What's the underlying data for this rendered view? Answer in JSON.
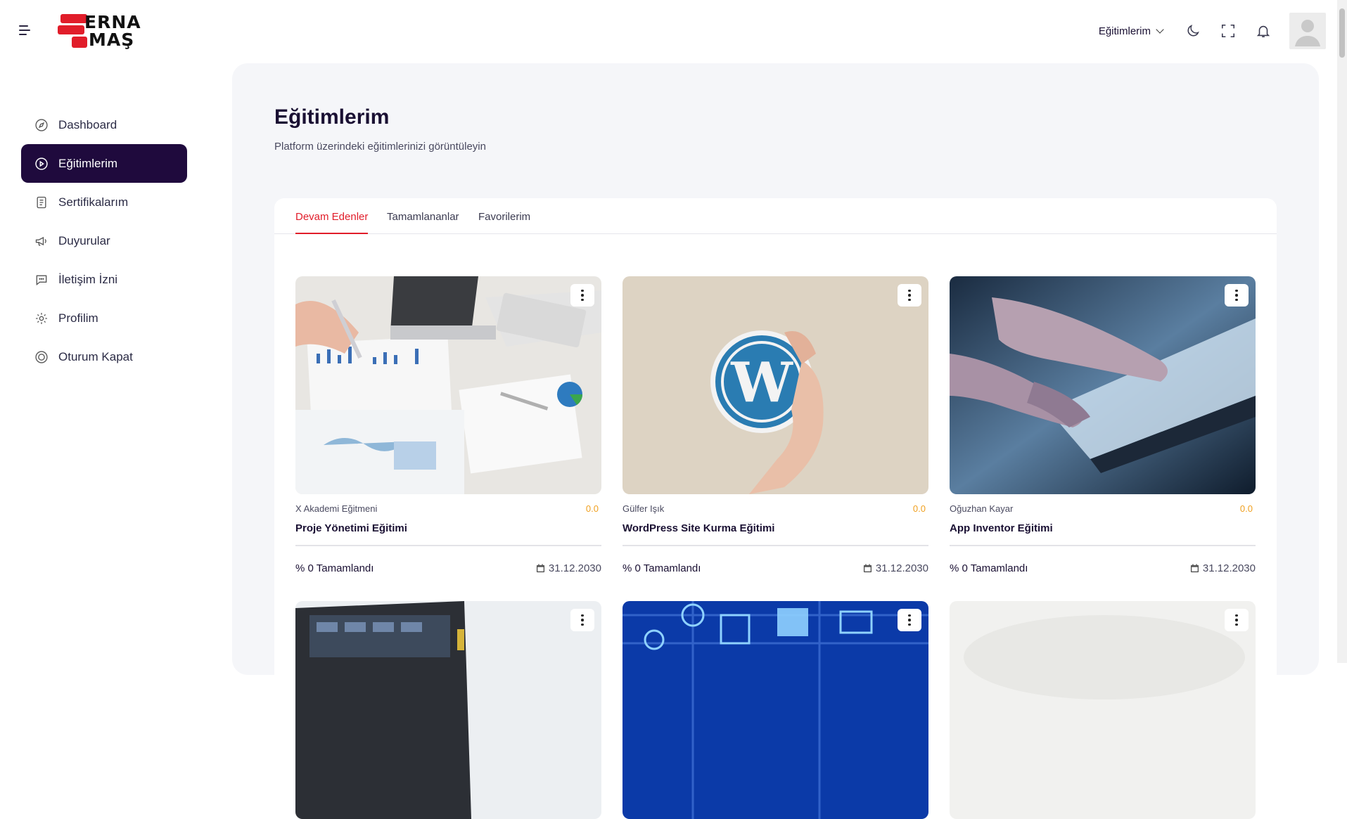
{
  "brand": {
    "logo_line1": "ERNA",
    "logo_line2": "MAŞ",
    "accent": "#e11d2a",
    "dark": "#1f0a3d"
  },
  "header": {
    "context_select": "Eğitimlerim",
    "icons": [
      "moon-icon",
      "fullscreen-icon",
      "bell-icon",
      "avatar"
    ]
  },
  "sidebar": {
    "items": [
      {
        "label": "Dashboard",
        "icon": "compass-icon",
        "active": false
      },
      {
        "label": "Eğitimlerim",
        "icon": "play-circle-icon",
        "active": true
      },
      {
        "label": "Sertifikalarım",
        "icon": "certificate-icon",
        "active": false
      },
      {
        "label": "Duyurular",
        "icon": "megaphone-icon",
        "active": false
      },
      {
        "label": "İletişim İzni",
        "icon": "chat-icon",
        "active": false
      },
      {
        "label": "Profilim",
        "icon": "gear-icon",
        "active": false
      },
      {
        "label": "Oturum Kapat",
        "icon": "logout-circle-icon",
        "active": false
      }
    ]
  },
  "main": {
    "title": "Eğitimlerim",
    "subtitle": "Platform üzerindeki eğitimlerinizi görüntüleyin",
    "tabs": [
      {
        "label": "Devam Edenler",
        "active": true
      },
      {
        "label": "Tamamlananlar",
        "active": false
      },
      {
        "label": "Favorilerim",
        "active": false
      }
    ],
    "courses": [
      {
        "instructor": "X Akademi Eğitmeni",
        "rating": "0.0",
        "title": "Proje Yönetimi Eğitimi",
        "progress": "% 0 Tamamlandı",
        "date": "31.12.2030",
        "image": "business-charts-photo"
      },
      {
        "instructor": "Gülfer Işık",
        "rating": "0.0",
        "title": "WordPress Site Kurma Eğitimi",
        "progress": "% 0 Tamamlandı",
        "date": "31.12.2030",
        "image": "wordpress-logo-photo"
      },
      {
        "instructor": "Oğuzhan Kayar",
        "rating": "0.0",
        "title": "App Inventor Eğitimi",
        "progress": "% 0 Tamamlandı",
        "date": "31.12.2030",
        "image": "tablet-touch-photo"
      },
      {
        "image": "software-screen-photo"
      },
      {
        "image": "social-icons-photo"
      },
      {
        "image": "white-photo"
      }
    ]
  }
}
